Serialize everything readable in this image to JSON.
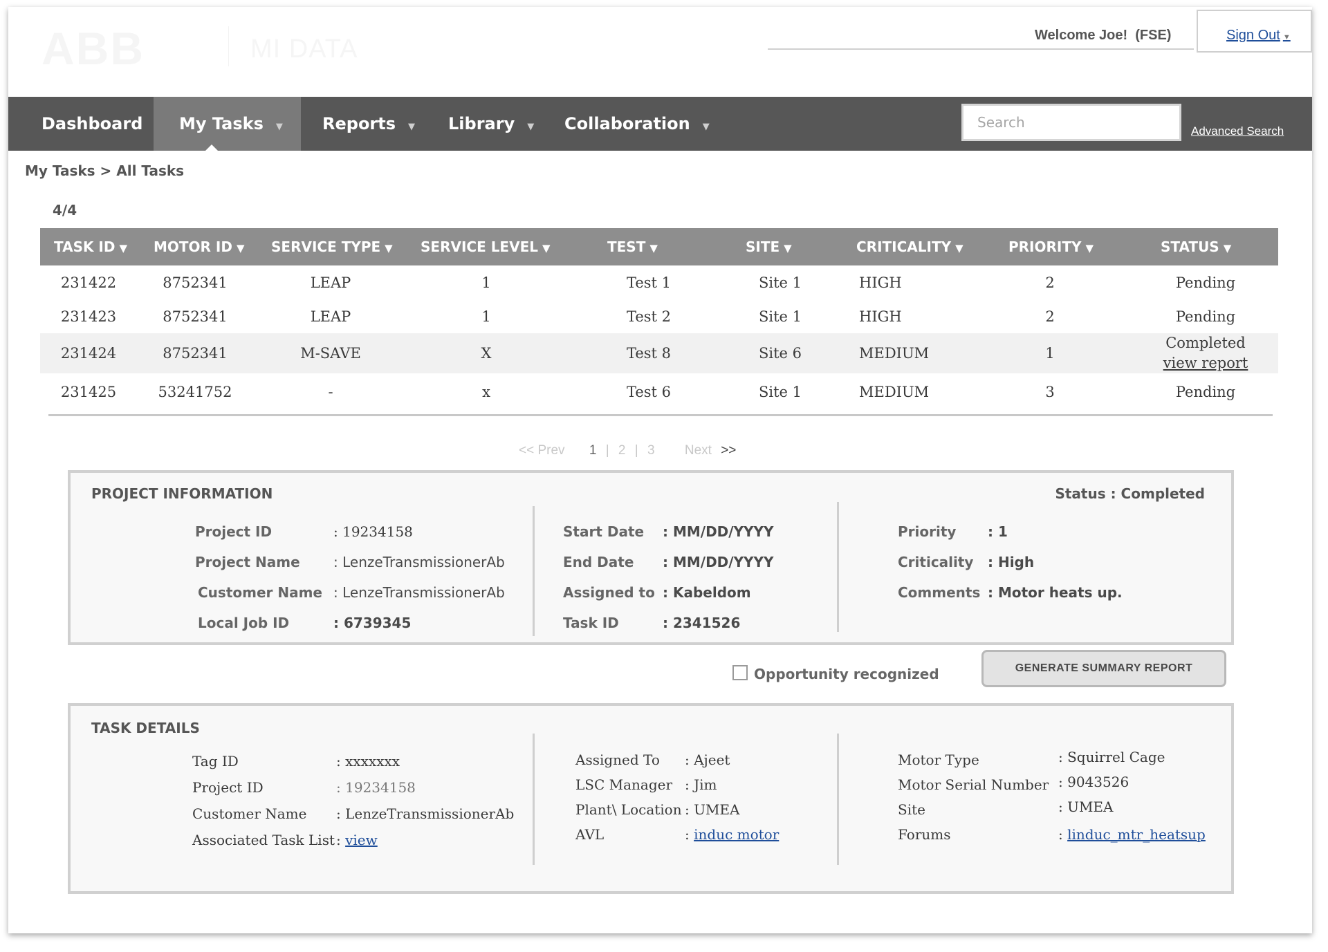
{
  "header": {
    "logo": "ABB",
    "app_name": "MI DATA",
    "welcome": "Welcome Joe!",
    "role": "(FSE)",
    "sign_out": "Sign Out"
  },
  "nav": {
    "items": [
      "Dashboard",
      "My Tasks",
      "Reports",
      "Library",
      "Collaboration"
    ],
    "active": "My Tasks",
    "search_placeholder": "Search",
    "advanced_search": "Advanced Search"
  },
  "breadcrumb": "My Tasks > All Tasks",
  "count": "4/4",
  "table": {
    "headers": [
      "TASK ID",
      "MOTOR ID",
      "SERVICE TYPE",
      "SERVICE LEVEL",
      "TEST",
      "SITE",
      "CRITICALITY",
      "PRIORITY",
      "STATUS"
    ],
    "rows": [
      {
        "task_id": "231422",
        "motor_id": "8752341",
        "service_type": "LEAP",
        "service_level": "1",
        "test": "Test 1",
        "site": "Site 1",
        "criticality": "HIGH",
        "priority": "2",
        "status": "Pending"
      },
      {
        "task_id": "231423",
        "motor_id": "8752341",
        "service_type": "LEAP",
        "service_level": "1",
        "test": "Test 2",
        "site": "Site 1",
        "criticality": "HIGH",
        "priority": "2",
        "status": "Pending"
      },
      {
        "task_id": "231424",
        "motor_id": "8752341",
        "service_type": "M-SAVE",
        "service_level": "X",
        "test": "Test 8",
        "site": "Site 6",
        "criticality": "MEDIUM",
        "priority": "1",
        "status": "Completed",
        "status_link": "view report"
      },
      {
        "task_id": "231425",
        "motor_id": "53241752",
        "service_type": "-",
        "service_level": "x",
        "test": "Test 6",
        "site": "Site 1",
        "criticality": "MEDIUM",
        "priority": "3",
        "status": "Pending"
      }
    ]
  },
  "pagination": {
    "prev": "<< Prev",
    "pages": [
      "1",
      "2",
      "3"
    ],
    "current": "1",
    "next": "Next",
    "next_arrows": ">>"
  },
  "project_info": {
    "title": "PROJECT INFORMATION",
    "status": "Status : Completed",
    "col1": [
      {
        "key": "Project ID",
        "value": ": 19234158"
      },
      {
        "key": "Project Name",
        "value": ":  LenzeTransmissionerAb"
      },
      {
        "key": "Customer Name",
        "value": ":  LenzeTransmissionerAb"
      },
      {
        "key": "Local Job ID",
        "value": ":  6739345"
      }
    ],
    "col2": [
      {
        "key": "Start Date",
        "value": ":  MM/DD/YYYY"
      },
      {
        "key": "End Date",
        "value": ":  MM/DD/YYYY"
      },
      {
        "key": "Assigned to",
        "value": ":  Kabeldom"
      },
      {
        "key": "Task ID",
        "value": ":  2341526"
      }
    ],
    "col3": [
      {
        "key": "Priority",
        "value": ":  1"
      },
      {
        "key": "Criticality",
        "value": ":  High"
      },
      {
        "key": "Comments",
        "value": ":  Motor heats up."
      }
    ]
  },
  "opportunity_label": "Opportunity recognized",
  "generate_button": "GENERATE SUMMARY REPORT",
  "task_details": {
    "title": "TASK DETAILS",
    "col1": [
      {
        "key": "Tag ID",
        "value": ": xxxxxxx"
      },
      {
        "key": "Project ID",
        "value": ": 19234158"
      },
      {
        "key": "Customer Name",
        "value": ": LenzeTransmissionerAb"
      },
      {
        "key": "Associated Task List",
        "value_prefix": ": ",
        "link": "view"
      }
    ],
    "col2": [
      {
        "key": "Assigned To",
        "value": ": Ajeet"
      },
      {
        "key": "LSC Manager",
        "value": ": Jim"
      },
      {
        "key": "Plant\\ Location",
        "value": ": UMEA"
      },
      {
        "key": "AVL",
        "value_prefix": ": ",
        "link": "induc motor"
      }
    ],
    "col3": [
      {
        "key": "Motor Type",
        "value": ": Squirrel Cage"
      },
      {
        "key": "Motor Serial Number",
        "value": ": 9043526"
      },
      {
        "key": "Site",
        "value": ": UMEA"
      },
      {
        "key": "Forums",
        "value_prefix": ": ",
        "link": "linduc_mtr_heatsup"
      }
    ]
  }
}
